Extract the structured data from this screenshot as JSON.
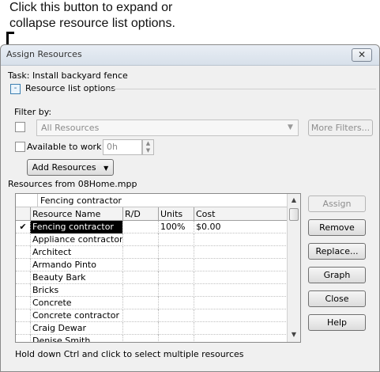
{
  "callout": {
    "line1": "Click this button to expand or",
    "line2": "collapse resource list options."
  },
  "dialog": {
    "title": "Assign Resources",
    "close_glyph": "✕"
  },
  "task": "Task: Install backyard fence",
  "resource_list_options": {
    "toggle_glyph": "-",
    "label": "Resource list options",
    "filter_label": "Filter by:",
    "filter_value": "All Resources",
    "more_filters": "More Filters...",
    "available_label": "Available to work",
    "available_value": "0h",
    "add_resources": "Add Resources"
  },
  "resources_from": "Resources from 08Home.mpp",
  "grid": {
    "edit_value": "Fencing contractor",
    "columns": [
      "Resource Name",
      "R/D",
      "Units",
      "Cost"
    ],
    "rows": [
      {
        "check": "✔",
        "name": "Fencing contractor",
        "rd": "",
        "units": "100%",
        "cost": "$0.00"
      },
      {
        "check": "",
        "name": "Appliance contractor",
        "rd": "",
        "units": "",
        "cost": ""
      },
      {
        "check": "",
        "name": "Architect",
        "rd": "",
        "units": "",
        "cost": ""
      },
      {
        "check": "",
        "name": "Armando Pinto",
        "rd": "",
        "units": "",
        "cost": ""
      },
      {
        "check": "",
        "name": "Beauty Bark",
        "rd": "",
        "units": "",
        "cost": ""
      },
      {
        "check": "",
        "name": "Bricks",
        "rd": "",
        "units": "",
        "cost": ""
      },
      {
        "check": "",
        "name": "Concrete",
        "rd": "",
        "units": "",
        "cost": ""
      },
      {
        "check": "",
        "name": "Concrete contractor",
        "rd": "",
        "units": "",
        "cost": ""
      },
      {
        "check": "",
        "name": "Craig Dewar",
        "rd": "",
        "units": "",
        "cost": ""
      },
      {
        "check": "",
        "name": "Denise Smith",
        "rd": "",
        "units": "",
        "cost": ""
      }
    ]
  },
  "buttons": {
    "assign": "Assign",
    "remove": "Remove",
    "replace": "Replace...",
    "graph": "Graph",
    "close": "Close",
    "help": "Help"
  },
  "hint": "Hold down Ctrl and click to select multiple resources"
}
